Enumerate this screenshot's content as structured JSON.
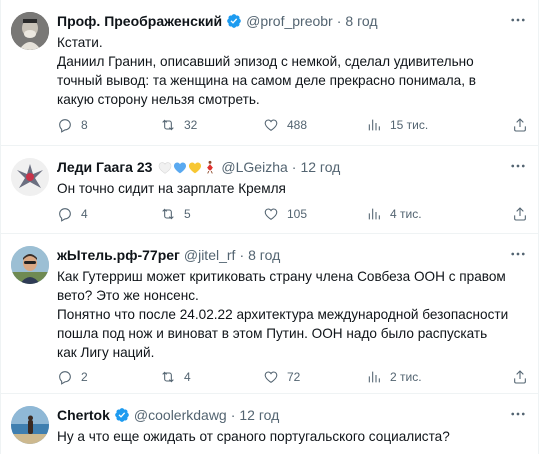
{
  "tweets": [
    {
      "name": "Проф. Преображенский",
      "handle": "@prof_preobr",
      "time": "8 год",
      "text": [
        "Кстати.",
        "Даниил Гранин, описавший эпизод с немкой, сделал удивительно",
        "точный вывод: та женщина на самом деле прекрасно понимала, в",
        "какую сторону нельзя смотреть."
      ],
      "replies": "8",
      "retweets": "32",
      "likes": "488",
      "views": "15 тис.",
      "verified": true
    },
    {
      "name": "Леди Гаага 23",
      "handle": "@LGeizha",
      "time": "12 год",
      "text": [
        "Он точно сидит на зарплате Кремля"
      ],
      "replies": "4",
      "retweets": "5",
      "likes": "105",
      "views": "4 тис.",
      "verified": false
    },
    {
      "name": "жЫтель.рф-77рег",
      "handle": "@jitel_rf",
      "time": "8 год",
      "text": [
        "Как Гутерриш может критиковать страну члена Совбеза ООН с правом",
        "вето? Это же нонсенс.",
        "Понятно что после 24.02.22 архитектура международной безопасности",
        "пошла под нож и виноват в этом Путин. ООН надо было распускать",
        "как Лигу наций."
      ],
      "replies": "2",
      "retweets": "4",
      "likes": "72",
      "views": "2 тис.",
      "verified": false
    },
    {
      "name": "Chertok",
      "handle": "@coolerkdawg",
      "time": "12 год",
      "text": [
        "Ну а что еще ожидать от сраного португальского социалиста?"
      ],
      "verified": true
    }
  ],
  "separator": "·",
  "colors": {
    "text": "#0f1419",
    "secondary": "#536471",
    "verified": "#1d9bf0",
    "border": "#eff3f4"
  },
  "icons": [
    "verified-badge-icon",
    "more-icon",
    "reply-icon",
    "retweet-icon",
    "like-icon",
    "views-icon",
    "share-icon"
  ]
}
